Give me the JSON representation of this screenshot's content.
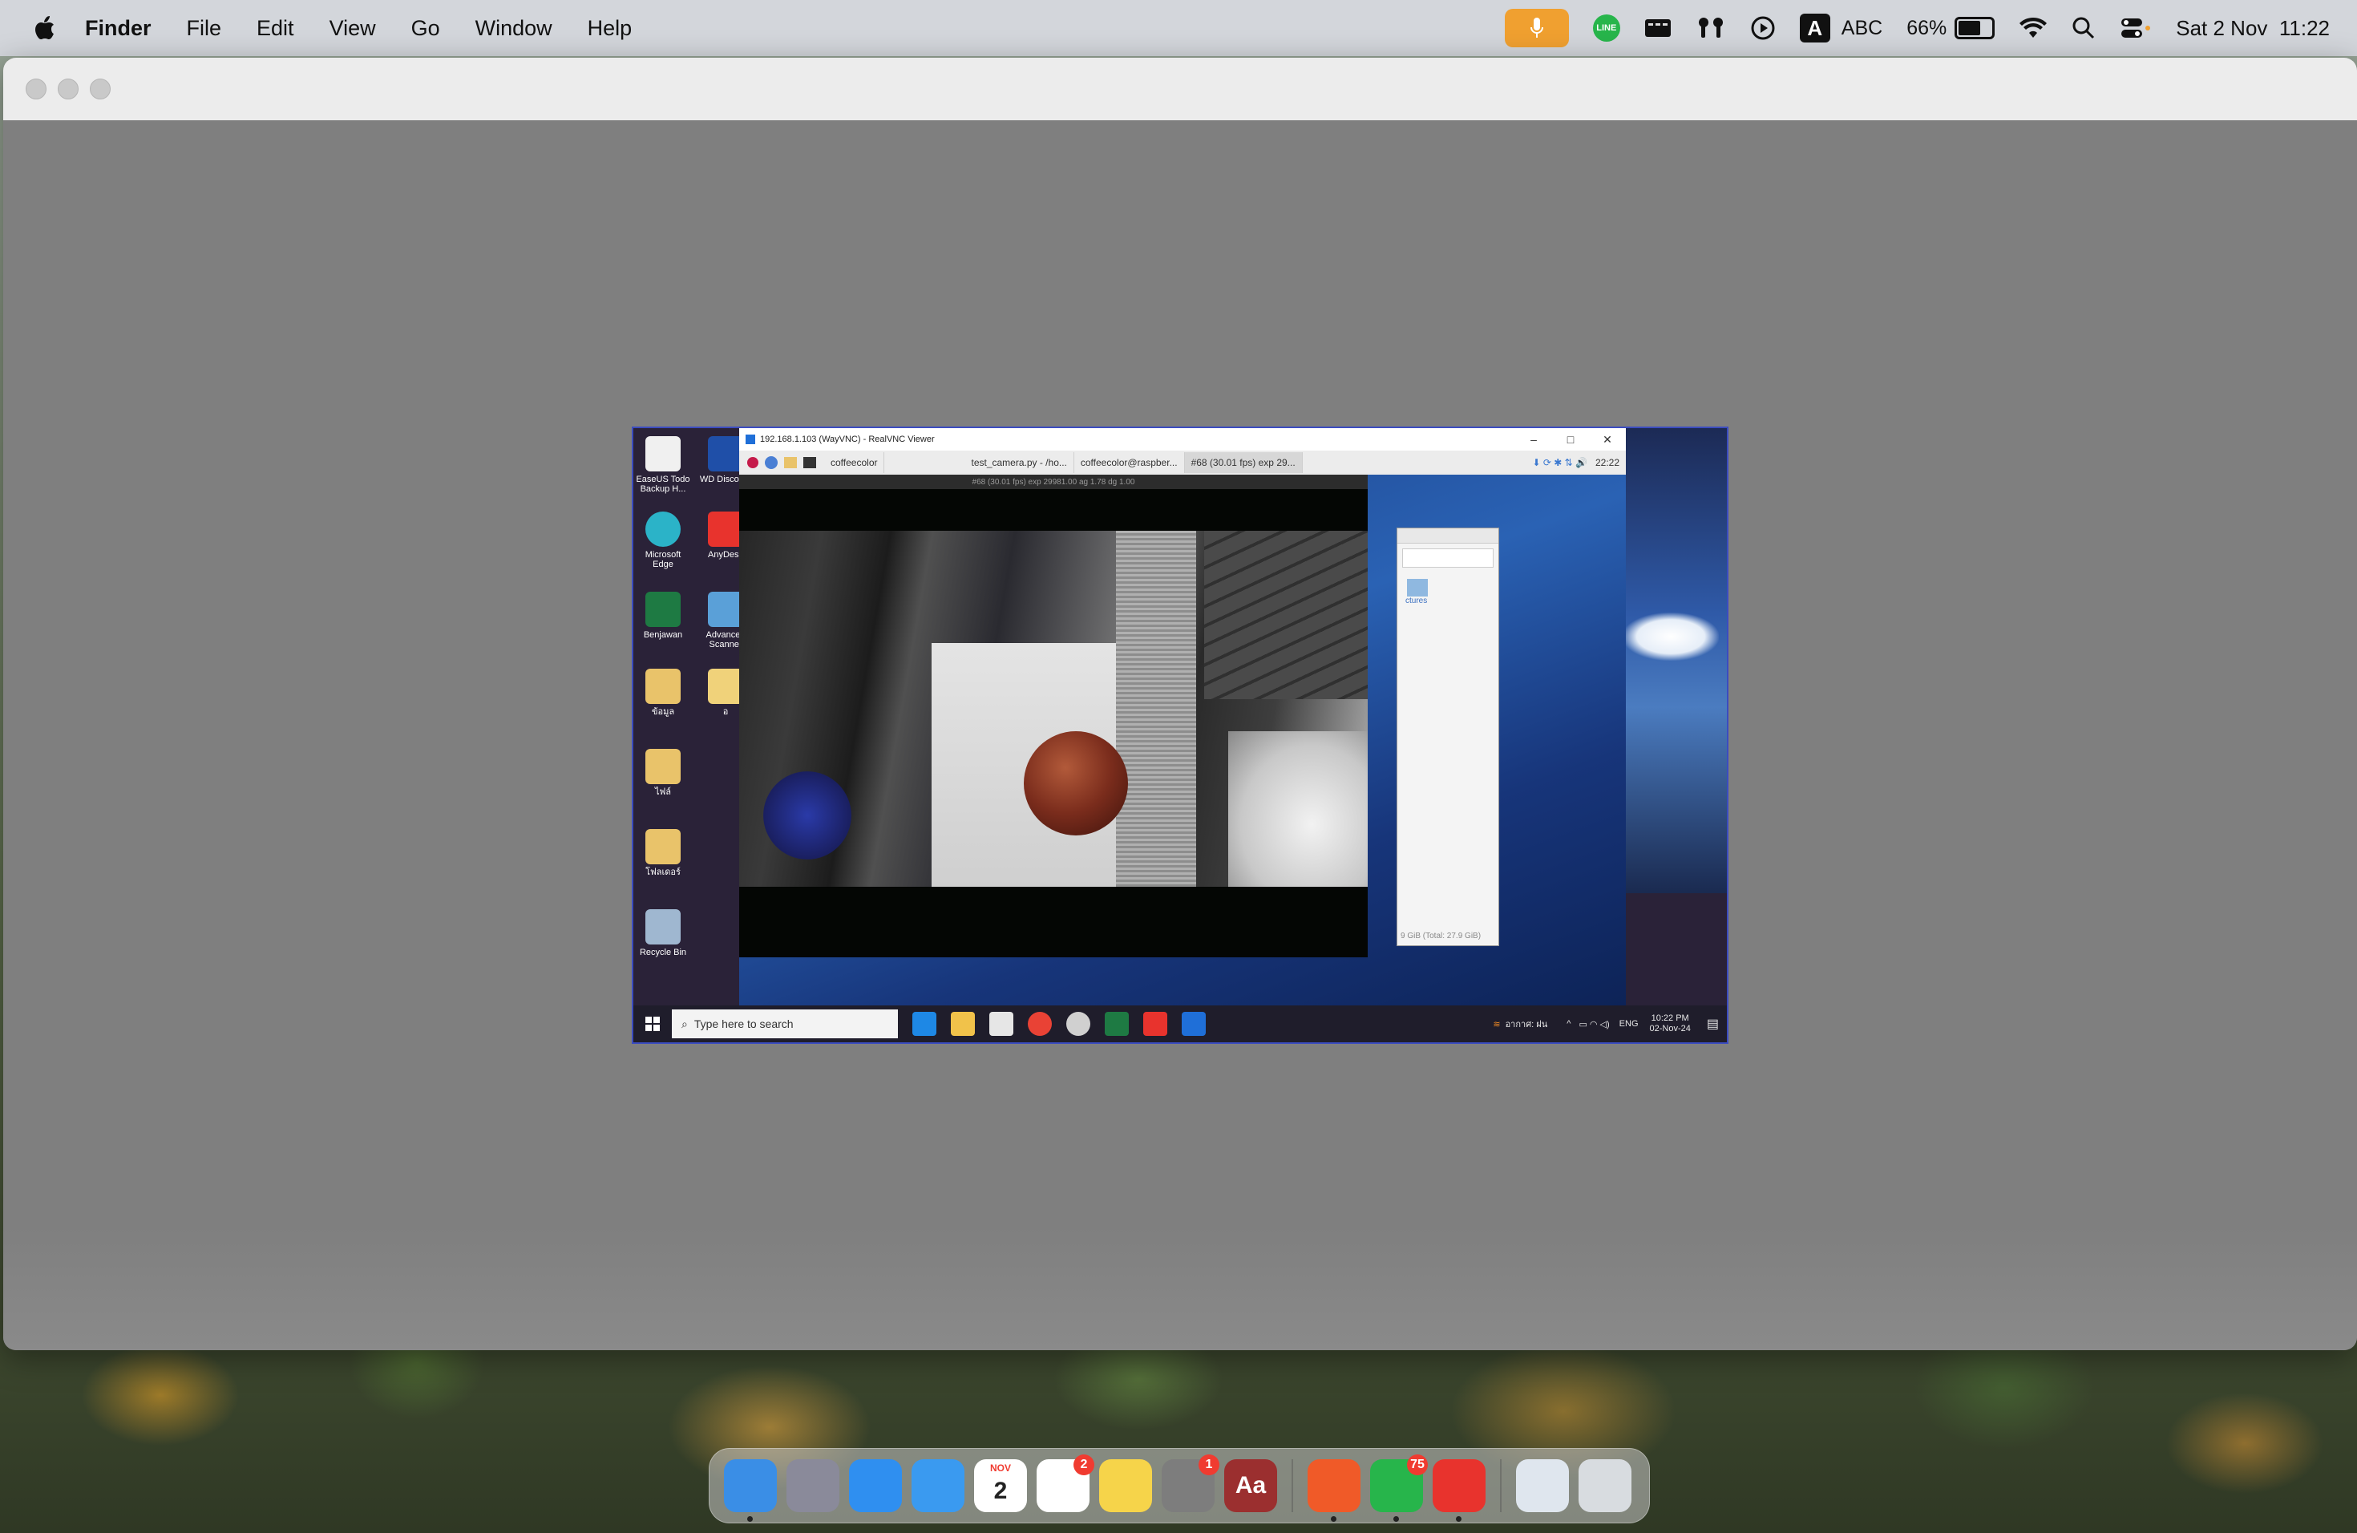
{
  "menubar": {
    "app_name": "Finder",
    "menus": [
      "File",
      "Edit",
      "View",
      "Go",
      "Window",
      "Help"
    ],
    "input_source": "ABC",
    "battery_percent": "66%",
    "datetime": "Sat 2 Nov  11:22",
    "icons": [
      "mic-icon",
      "line-icon",
      "display-icon",
      "airpods-icon",
      "play-icon",
      "a-input-icon",
      "wifi-icon",
      "search-icon",
      "control-center-icon"
    ]
  },
  "remote_desktop": {
    "desktop_icons": [
      {
        "label": "EaseUS Todo Backup H...",
        "color": "#e8e8e8"
      },
      {
        "label": "WD Discover",
        "color": "#1f4fa8"
      },
      {
        "label": "Microsoft Edge",
        "color": "#2bb3c8"
      },
      {
        "label": "AnyDesk",
        "color": "#e8332d"
      },
      {
        "label": "Benjawan",
        "color": "#1e7a43"
      },
      {
        "label": "Advanced Scanner",
        "color": "#5aa0d8"
      },
      {
        "label": "ข้อมูล",
        "color": "#e9c36a"
      },
      {
        "label": "อ",
        "color": "#f0d27a"
      },
      {
        "label": "ไฟล์",
        "color": "#e9c36a"
      },
      {
        "label": "โฟลเดอร์",
        "color": "#e9c36a"
      },
      {
        "label": "Recycle Bin",
        "color": "#9fb7d0"
      }
    ],
    "vnc_window": {
      "title": "192.168.1.103 (WayVNC) - RealVNC Viewer",
      "controls": [
        "–",
        "□",
        "✕"
      ],
      "pi_tabs": [
        "coffeecolor",
        "test_camera.py - /ho...",
        "coffeecolor@raspber...",
        "#68 (30.01 fps) exp 29..."
      ],
      "pi_clock": "22:22",
      "camera_window_title": "#68 (30.01 fps) exp 29981.00 ag 1.78 dg 1.00",
      "file_manager_status": "9 GiB (Total: 27.9 GiB)",
      "file_manager_item": "ctures"
    },
    "taskbar": {
      "search_placeholder": "Type here to search",
      "weather": "อากาศ: ฝน",
      "language": "ENG",
      "time": "10:22 PM",
      "date": "02-Nov-24"
    }
  },
  "dock": {
    "apps": [
      {
        "name": "Finder",
        "icon": "finder-icon",
        "color": "#3a8ee6",
        "running": true
      },
      {
        "name": "Launchpad",
        "icon": "launchpad-icon",
        "color": "#8a8a9a",
        "running": false
      },
      {
        "name": "Safari",
        "icon": "safari-icon",
        "color": "#2f8ff0",
        "running": false
      },
      {
        "name": "Mail",
        "icon": "mail-icon",
        "color": "#3a9af0",
        "running": false
      },
      {
        "name": "Calendar",
        "icon": "calendar-icon",
        "color": "#ffffff",
        "running": false,
        "text": "2",
        "month": "NOV"
      },
      {
        "name": "Reminders",
        "icon": "reminders-icon",
        "color": "#ffffff",
        "running": false,
        "badge": "2"
      },
      {
        "name": "Notes",
        "icon": "notes-icon",
        "color": "#f6d44a",
        "running": false
      },
      {
        "name": "System Settings",
        "icon": "settings-icon",
        "color": "#7d7d7d",
        "running": false,
        "badge": "1"
      },
      {
        "name": "Dictionary",
        "icon": "dictionary-icon",
        "color": "#9b2f2f",
        "running": false,
        "text": "Aa"
      },
      {
        "name": "Brave",
        "icon": "brave-icon",
        "color": "#f05a28",
        "running": true
      },
      {
        "name": "LINE",
        "icon": "line-icon",
        "color": "#27b54b",
        "running": true,
        "badge": "75"
      },
      {
        "name": "AnyDesk",
        "icon": "anydesk-icon",
        "color": "#e8332d",
        "running": true
      },
      {
        "name": "Downloads",
        "icon": "downloads-stack-icon",
        "color": "#dfe6ee",
        "running": false
      },
      {
        "name": "Trash",
        "icon": "trash-icon",
        "color": "#d8dce0",
        "running": false
      }
    ]
  }
}
